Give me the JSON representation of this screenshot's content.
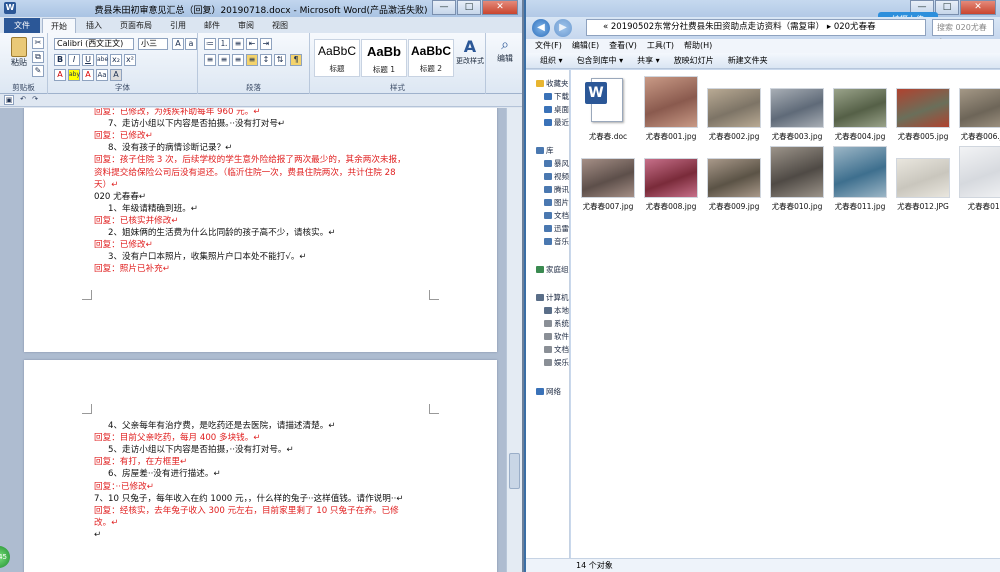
{
  "word": {
    "title": "费县朱田初审意见汇总（回复）20190718.docx - Microsoft Word(产品激活失败)",
    "app_letter": "W",
    "window_controls": {
      "minimize": "—",
      "maximize": "□",
      "close": "✕"
    },
    "tabs": [
      "文件",
      "开始",
      "插入",
      "页面布局",
      "引用",
      "邮件",
      "审阅",
      "视图"
    ],
    "active_tab": "开始",
    "clipboard": {
      "paste": "粘贴",
      "label": "剪贴板"
    },
    "font": {
      "name": "Calibri (西文正文)",
      "size": "小三",
      "label": "字体",
      "row2": [
        "B",
        "I",
        "U",
        "abe",
        "x₂",
        "x²"
      ],
      "row3": [
        "A",
        "aby",
        "A",
        "Aa",
        "A"
      ]
    },
    "paragraph": {
      "label": "段落"
    },
    "styles": {
      "label": "样式",
      "items": [
        {
          "sample": "AaBbC",
          "name": "标题"
        },
        {
          "sample": "AaBb",
          "name": "标题 1"
        },
        {
          "sample": "AaBbC",
          "name": "标题 2"
        }
      ],
      "change": "更改样式"
    },
    "edit": {
      "label": "编辑"
    },
    "page1": {
      "lines": [
        {
          "text": "回复：已修改，为残疾补助每年 960 元。↵",
          "red": true,
          "indent": 0
        },
        {
          "text": "7、走访小组以下内容是否拍摄。··没有打对号↵",
          "red": false,
          "indent": 14
        },
        {
          "text": "回复：已修改↵",
          "red": true,
          "indent": 0
        },
        {
          "text": "8、没有孩子的病情诊断记录？↵",
          "red": false,
          "indent": 14
        },
        {
          "text": "回复：孩子住院 3 次，后续学校的学生意外险给报了两次最少的，其余两次未报，",
          "red": true,
          "indent": 0
        },
        {
          "text": "资料提交给保险公司后没有退还。（临沂住院一次，费县住院两次，共计住院 28",
          "red": true,
          "indent": 0
        },
        {
          "text": "天）↵",
          "red": true,
          "indent": 0
        },
        {
          "text": "020 尤春春↵",
          "red": false,
          "indent": 0
        },
        {
          "text": "1、年级请精确到班。↵",
          "red": false,
          "indent": 14
        },
        {
          "text": "回复：已核实并修改↵",
          "red": true,
          "indent": 0
        },
        {
          "text": "2、姐妹俩的生活费为什么比同龄的孩子高不少，请核实。↵",
          "red": false,
          "indent": 14
        },
        {
          "text": "回复：已修改↵",
          "red": true,
          "indent": 0
        },
        {
          "text": "3、没有户口本照片，收集照片户口本处不能打√。↵",
          "red": false,
          "indent": 14
        },
        {
          "text": "回复：照片已补充↵",
          "red": true,
          "indent": 0
        }
      ]
    },
    "page2": {
      "lines": [
        {
          "text": "4、父亲每年有治疗费，是吃药还是去医院，请描述清楚。↵",
          "red": false,
          "indent": 14
        },
        {
          "text": "回复：目前父亲吃药，每月 400 多块钱。↵",
          "red": true,
          "indent": 0
        },
        {
          "text": "5、走访小组以下内容是否拍摄，··没有打对号。↵",
          "red": false,
          "indent": 14
        },
        {
          "text": "回复：有打，在方框里↵",
          "red": true,
          "indent": 0
        },
        {
          "text": "6、房屋差··没有进行描述。↵",
          "red": false,
          "indent": 14
        },
        {
          "text": "回复：··已修改↵",
          "red": true,
          "indent": 0
        },
        {
          "text": "7、10 只兔子，每年收入在约 1000 元，，什么样的兔子··这样值钱。请作说明··↵",
          "red": false,
          "indent": 0
        },
        {
          "text": "回复：经核实，去年兔子收入 300 元左右，目前家里剩了 10 只兔子在养。已修",
          "red": true,
          "indent": 0
        },
        {
          "text": "改。↵",
          "red": true,
          "indent": 0
        },
        {
          "text": "↵",
          "red": false,
          "indent": 0
        }
      ]
    }
  },
  "explorer": {
    "address": "« 20190502东常分社费县朱田资助点走访资料（需复审） ▸ 020尤春春",
    "search_placeholder": "搜索 020尤春春",
    "pin_label": "拍摄上传",
    "menu": [
      "文件(F)",
      "编辑(E)",
      "查看(V)",
      "工具(T)",
      "帮助(H)"
    ],
    "toolbar": [
      "组织 ▾",
      "包含到库中 ▾",
      "共享 ▾",
      "放映幻灯片",
      "新建文件夹"
    ],
    "nav": [
      {
        "label": "收藏夹",
        "color": "#e8b530"
      },
      {
        "label": "下载",
        "color": "#3a72b8"
      },
      {
        "label": "桌面",
        "color": "#3a72b8"
      },
      {
        "label": "最近",
        "color": "#3a72b8"
      },
      {
        "label": "库",
        "color": "#4a78b0"
      },
      {
        "label": "暴风",
        "color": "#4a78b0"
      },
      {
        "label": "视频",
        "color": "#4a78b0"
      },
      {
        "label": "腾讯",
        "color": "#4a78b0"
      },
      {
        "label": "图片",
        "color": "#4a78b0"
      },
      {
        "label": "文档",
        "color": "#4a78b0"
      },
      {
        "label": "迅雷",
        "color": "#4a78b0"
      },
      {
        "label": "音乐",
        "color": "#4a78b0"
      },
      {
        "label": "家庭组",
        "color": "#3a8a50"
      },
      {
        "label": "计算机",
        "color": "#5a6e88"
      },
      {
        "label": "本地",
        "color": "#5a6e88"
      },
      {
        "label": "系统",
        "color": "#8a8f96"
      },
      {
        "label": "软件",
        "color": "#8a8f96"
      },
      {
        "label": "文档",
        "color": "#8a8f96"
      },
      {
        "label": "娱乐",
        "color": "#8a8f96"
      },
      {
        "label": "网络",
        "color": "#3a72b8"
      }
    ],
    "files": [
      {
        "name": "尤春春.doc",
        "kind": "doc",
        "c1": "#ffffff",
        "c2": "#ffffff"
      },
      {
        "name": "尤春春001.jpg",
        "kind": "photo",
        "c1": "#8a5a4e",
        "c2": "#c99a86"
      },
      {
        "name": "尤春春002.jpg",
        "kind": "photo-wide",
        "c1": "#7d7466",
        "c2": "#b9aa94"
      },
      {
        "name": "尤春春003.jpg",
        "kind": "photo-wide",
        "c1": "#5f6a78",
        "c2": "#a8aeb5"
      },
      {
        "name": "尤春春004.jpg",
        "kind": "photo-wide",
        "c1": "#556047",
        "c2": "#9aa38a"
      },
      {
        "name": "尤春春005.jpg",
        "kind": "photo-wide",
        "c1": "#6a6f5a",
        "c2": "#b0422f"
      },
      {
        "name": "尤春春006.jpg",
        "kind": "photo-wide",
        "c1": "#6d6558",
        "c2": "#a49886"
      },
      {
        "name": "尤春春007.jpg",
        "kind": "photo-wide",
        "c1": "#5d4f4a",
        "c2": "#a58f86"
      },
      {
        "name": "尤春春008.jpg",
        "kind": "photo-wide",
        "c1": "#7a2b3a",
        "c2": "#c7708a"
      },
      {
        "name": "尤春春009.jpg",
        "kind": "photo-wide",
        "c1": "#5b5346",
        "c2": "#a9998a"
      },
      {
        "name": "尤春春010.jpg",
        "kind": "photo",
        "c1": "#4f4a45",
        "c2": "#9c948a"
      },
      {
        "name": "尤春春011.jpg",
        "kind": "photo",
        "c1": "#3e6f8e",
        "c2": "#9cb6c6"
      },
      {
        "name": "尤春春012.JPG",
        "kind": "photo-wide",
        "c1": "#c9c6bd",
        "c2": "#e9e6de"
      },
      {
        "name": "尤春春013",
        "kind": "photo",
        "c1": "#d6d9de",
        "c2": "#f2f3f5"
      }
    ],
    "status": "14 个对象"
  },
  "taskbar_badge": "45"
}
